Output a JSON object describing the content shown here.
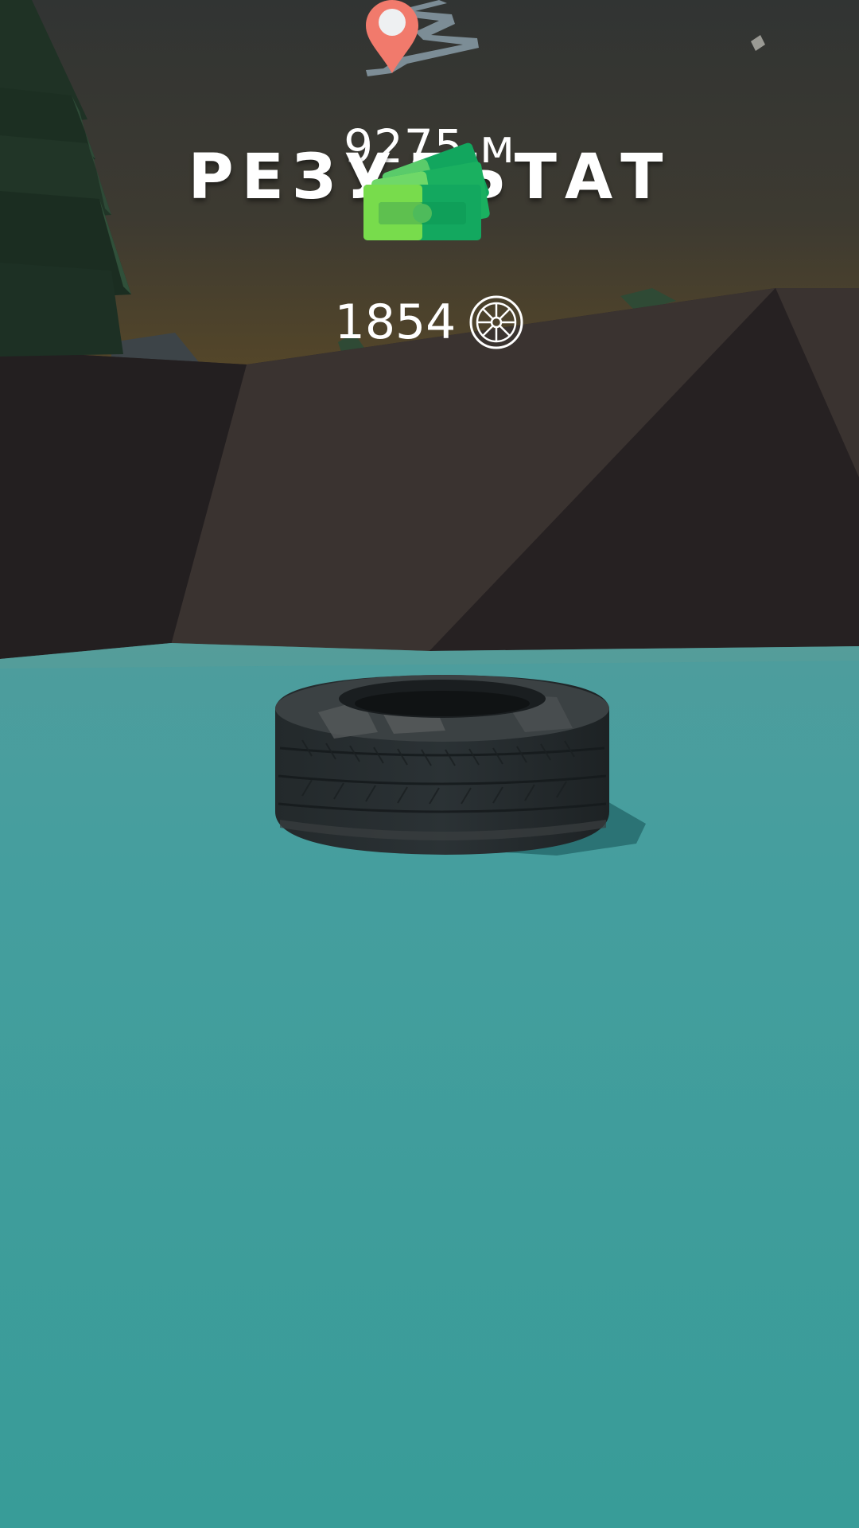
{
  "hud": {
    "distance": "9275 м",
    "title": "РЕЗУЛЬТАТ",
    "reward_amount": "1854"
  },
  "icons": {
    "distance": "map-pin-icon",
    "money": "cash-stack-icon",
    "currency": "wheel-rim-icon"
  },
  "colors": {
    "sky_top": "#323433",
    "sky_horizon": "#4a4030",
    "mountain_dark": "#231f20",
    "mountain_mid": "#332d2c",
    "ground": "#3a9a98",
    "pin": "#f07a6c",
    "cash_light": "#76d85a",
    "cash_dark": "#12a65e"
  }
}
